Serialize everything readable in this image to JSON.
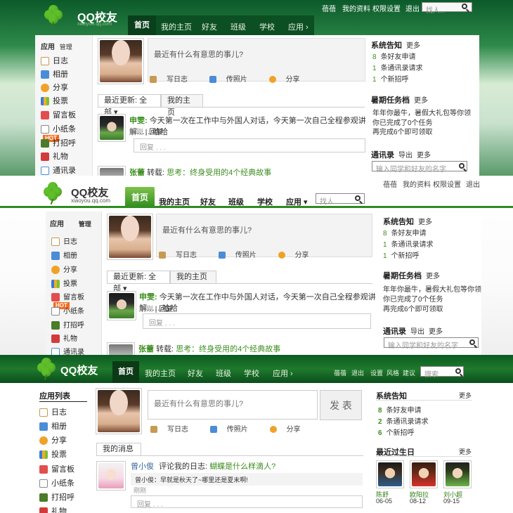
{
  "colors": {
    "brand_green": "#2d8b1e",
    "nav_dark": "#0c4f23",
    "link_green": "#3d8e1f",
    "hot": "#f36b20"
  },
  "p1": {
    "logo_text": "QQ校友",
    "logo_sub": "xiaoyou.qq.com",
    "toplinks": [
      "蓓蓓",
      "我的资料",
      "权限设置",
      "退出"
    ],
    "search_placeholder": "找人...",
    "nav": [
      "首页",
      "我的主页",
      "好友",
      "班级",
      "学校",
      "应用 ›"
    ],
    "sidebar_title": "应用",
    "sidebar_manage": "管理",
    "sidebar_items": [
      "日志",
      "相册",
      "分享",
      "投票",
      "留言板",
      "小纸条",
      "打招呼",
      "礼物",
      "通讯录"
    ],
    "status_placeholder": "最近有什么有意思的事儿?",
    "status_actions": [
      "写日志",
      "传照片",
      "分享"
    ],
    "tab1": "最近更新: 全部 ▾",
    "tab2": "我的主页",
    "feed_name": "申雯:",
    "feed_text": "今天第一次在工作中与外国人对话，今天第一次自己全程参观讲解……哈哈",
    "feed_time": "刚刚",
    "feed_reply_link": "回复",
    "feed_reply_box": "回复 . . .",
    "feed2_name": "张蕾",
    "feed2_verb": "转载:",
    "feed2_title": "思考：终身受用的4个经典故事",
    "notice_title": "系统告知",
    "notice_more": "更多",
    "notices": [
      {
        "n": "8",
        "t": "条好友申请"
      },
      {
        "n": "1",
        "t": "条通讯录请求"
      },
      {
        "n": "1",
        "t": "个新招呼"
      }
    ],
    "task_title": "暑期任务档",
    "task_more": "更多",
    "task_lines": [
      "年年你最牛，暑假大礼包等你领",
      "你已完成了0个任务",
      "再完成6个即可领取"
    ],
    "contacts_title": "通讯录",
    "contacts_export": "导出",
    "contacts_more": "更多",
    "contacts_placeholder": "输入同学和好友的名字..."
  },
  "p2": {
    "logo_text": "QQ校友",
    "logo_sub": "xiaoyou.qq.com",
    "toplinks": [
      "蓓蓓",
      "我的资料",
      "权限设置",
      "退出"
    ],
    "search_placeholder": "找人...",
    "tabs": [
      "首页",
      "我的主页",
      "好友",
      "班级",
      "学校",
      "应用 ▾"
    ],
    "sidebar_title": "应用",
    "sidebar_manage": "管理",
    "sidebar_items": [
      "日志",
      "相册",
      "分享",
      "投票",
      "留言板",
      "小纸条",
      "打招呼",
      "礼物",
      "通讯录"
    ],
    "hot": "HOT",
    "status_placeholder": "最近有什么有意思的事儿?",
    "status_actions": [
      "写日志",
      "传照片",
      "分享"
    ],
    "tab1": "最近更新: 全部 ▾",
    "tab2": "我的主页",
    "feed_name": "申雯:",
    "feed_text": "今天第一次在工作中与外国人对话，今天第一次自己全程参观讲解……哈哈",
    "feed_time": "刚刚",
    "feed_reply_link": "回复",
    "feed_reply_box": "回复 . . .",
    "feed2_name": "张蕾",
    "feed2_verb": "转载:",
    "feed2_title": "思考：终身受用的4个经典故事",
    "notice_title": "系统告知",
    "notice_more": "更多",
    "notices": [
      {
        "n": "8",
        "t": "条好友申请"
      },
      {
        "n": "1",
        "t": "条通讯录请求"
      },
      {
        "n": "1",
        "t": "个新招呼"
      }
    ],
    "task_title": "暑期任务档",
    "task_more": "更多",
    "task_lines": [
      "年年你最牛，暑假大礼包等你领",
      "你已完成了0个任务",
      "再完成6个即可领取"
    ],
    "contacts_title": "通讯录",
    "contacts_export": "导出",
    "contacts_more": "更多",
    "contacts_placeholder": "输入同学和好友的名字..."
  },
  "p3": {
    "logo_text": "QQ校友",
    "tabs": [
      "首页",
      "我的主页",
      "好友",
      "班级",
      "学校",
      "应用 ›"
    ],
    "rightlinks": [
      "蓓蓓",
      "退出",
      "设置",
      "风格",
      "建议"
    ],
    "search_placeholder": "搜索...",
    "sidebar_title": "应用列表",
    "sidebar_items": [
      "日志",
      "相册",
      "分享",
      "投票",
      "留言板",
      "小纸条",
      "打招呼",
      "礼物"
    ],
    "status_placeholder": "最近有什么有意思的事儿?",
    "publish": "发 表",
    "status_actions": [
      "写日志",
      "传照片",
      "分享"
    ],
    "msg_tab": "我的消息",
    "msg_name": "曾小俊",
    "msg_verb": "评论我的日志:",
    "msg_title": "蝴蝶是什么样滴人?",
    "msg_quote": "曾小俊：早就是秋天了~哪里还是夏末啊!",
    "msg_time": "刚刚",
    "msg_reply_box": "回复 . . .",
    "notice_title": "系统告知",
    "notice_more": "更多",
    "notices": [
      {
        "n": "8",
        "t": "条好友申请"
      },
      {
        "n": "2",
        "t": "条通讯录请求"
      },
      {
        "n": "6",
        "t": "个新招呼"
      }
    ],
    "bday_title": "最近过生日",
    "bday_more": "更多",
    "birthdays": [
      {
        "name": "陈舒",
        "date": "06-05"
      },
      {
        "name": "欧阳拉",
        "date": "08-12"
      },
      {
        "name": "刘小超",
        "date": "09-15"
      }
    ]
  }
}
